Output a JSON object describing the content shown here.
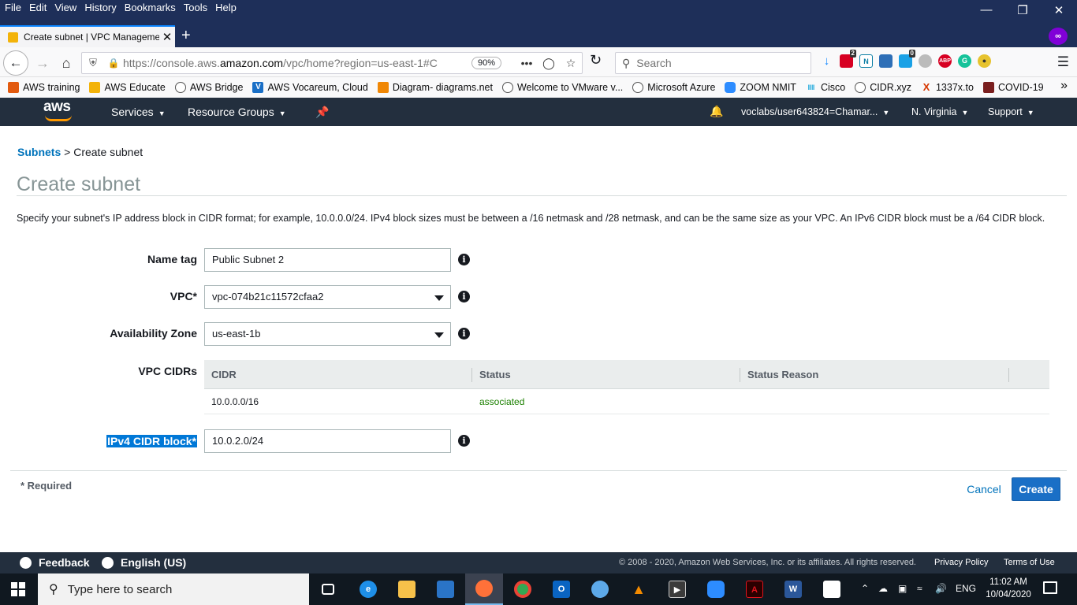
{
  "browser": {
    "menu": [
      "File",
      "Edit",
      "View",
      "History",
      "Bookmarks",
      "Tools",
      "Help"
    ],
    "tab_title": "Create subnet | VPC Management",
    "url_prefix": "https://console.aws.",
    "url_domain": "amazon.com",
    "url_rest": "/vpc/home?region=us-east-1#C",
    "zoom": "90%",
    "search_placeholder": "Search",
    "ext_badges": {
      "ext1": "2",
      "ext2": "0"
    },
    "bookmarks": [
      {
        "label": "AWS training",
        "icon": "aws-icon",
        "color": "#e25a0f"
      },
      {
        "label": "AWS Educate",
        "icon": "aws-box-icon",
        "color": "#f3b30a"
      },
      {
        "label": "AWS Bridge",
        "icon": "globe-icon",
        "color": "#555555"
      },
      {
        "label": "AWS Vocareum, Cloud",
        "icon": "vocareum-icon",
        "color": "#1a6fc6"
      },
      {
        "label": "Diagram- diagrams.net",
        "icon": "diagrams-icon",
        "color": "#f08705"
      },
      {
        "label": "Welcome to VMware v...",
        "icon": "globe-icon",
        "color": "#555555"
      },
      {
        "label": "Microsoft Azure",
        "icon": "globe-icon",
        "color": "#555555"
      },
      {
        "label": "ZOOM NMIT",
        "icon": "zoom-icon",
        "color": "#2d8cff"
      },
      {
        "label": "Cisco",
        "icon": "cisco-icon",
        "color": "#049fd9"
      },
      {
        "label": "CIDR.xyz",
        "icon": "globe-icon",
        "color": "#555555"
      },
      {
        "label": "1337x.to",
        "icon": "1337x-icon",
        "color": "#d63600"
      },
      {
        "label": "COVID-19",
        "icon": "covid-icon",
        "color": "#7a1f1f"
      }
    ]
  },
  "aws": {
    "logo": "aws",
    "services": "Services",
    "resource_groups": "Resource Groups",
    "account": "voclabs/user643824=Chamar...",
    "region": "N. Virginia",
    "support": "Support"
  },
  "page": {
    "breadcrumb_link": "Subnets",
    "breadcrumb_sep": ">",
    "breadcrumb_current": "Create subnet",
    "title": "Create subnet",
    "description": "Specify your subnet's IP address block in CIDR format; for example, 10.0.0.0/24. IPv4 block sizes must be between a /16 netmask and /28 netmask, and can be the same size as your VPC. An IPv6 CIDR block must be a /64 CIDR block.",
    "form": {
      "name_tag_label": "Name tag",
      "name_tag_value": "Public Subnet 2",
      "vpc_label": "VPC*",
      "vpc_value": "vpc-074b21c11572cfaa2",
      "az_label": "Availability Zone",
      "az_value": "us-east-1b",
      "vpc_cidrs_label": "VPC CIDRs",
      "cidr_columns": [
        "CIDR",
        "Status",
        "Status Reason"
      ],
      "cidr_rows": [
        {
          "cidr": "10.0.0.0/16",
          "status": "associated",
          "reason": ""
        }
      ],
      "ipv4_label": "IPv4 CIDR block*",
      "ipv4_value": "10.0.2.0/24"
    },
    "required_note": "* Required",
    "cancel": "Cancel",
    "create": "Create"
  },
  "footer": {
    "feedback": "Feedback",
    "language": "English (US)",
    "copyright": "© 2008 - 2020, Amazon Web Services, Inc. or its affiliates. All rights reserved.",
    "privacy": "Privacy Policy",
    "terms": "Terms of Use"
  },
  "taskbar": {
    "search_placeholder": "Type here to search",
    "lang": "ENG",
    "time": "11:02 AM",
    "date": "10/04/2020"
  }
}
